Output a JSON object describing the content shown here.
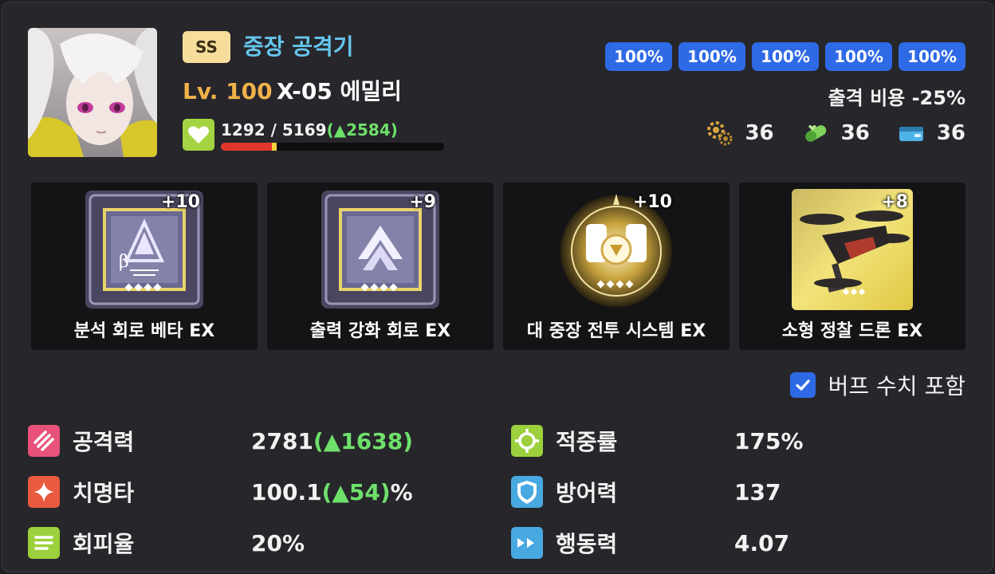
{
  "character": {
    "grade": "SS",
    "class": "중장 공격기",
    "level_label": "Lv. 100",
    "name": "X-05 에밀리",
    "affinity": {
      "current": "1292",
      "separator": " / ",
      "max": "5169",
      "bonus_open": "(",
      "bonus": "▲2584",
      "bonus_close": ")",
      "fill_fraction": 0.25
    }
  },
  "parts_percentages": [
    "100%",
    "100%",
    "100%",
    "100%",
    "100%"
  ],
  "sortie_cost": "출격 비용 -25%",
  "resources": [
    {
      "icon": "gear-parts-icon",
      "value": "36"
    },
    {
      "icon": "capsule-icon",
      "value": "36"
    },
    {
      "icon": "wallet-icon",
      "value": "36"
    }
  ],
  "equipment": [
    {
      "name": "분석 회로 베타 EX",
      "plus": "+10",
      "icon": "analysis-circuit-beta-icon"
    },
    {
      "name": "출력 강화 회로 EX",
      "plus": "+9",
      "icon": "output-circuit-icon"
    },
    {
      "name": "대 중장 전투 시스템 EX",
      "plus": "+10",
      "icon": "heavy-combat-system-icon"
    },
    {
      "name": "소형 정찰 드론 EX",
      "plus": "+8",
      "icon": "scout-drone-icon"
    }
  ],
  "buff_toggle": {
    "label": "버프 수치 포함",
    "checked": true
  },
  "stats": {
    "attack": {
      "label": "공격력",
      "base": "2781",
      "open": "(",
      "bonus": "▲1638",
      "close": ")",
      "suffix": ""
    },
    "crit": {
      "label": "치명타",
      "base": "100.1",
      "open": "(",
      "bonus": "▲54",
      "close": ")",
      "suffix": "%"
    },
    "evasion": {
      "label": "회피율",
      "base": "20%"
    },
    "accuracy": {
      "label": "적중률",
      "base": "175%"
    },
    "defense": {
      "label": "방어력",
      "base": "137"
    },
    "mobility": {
      "label": "행동력",
      "base": "4.07"
    }
  },
  "colors": {
    "accent_blue": "#2f6ae6",
    "grade_badge": "#f6dd9b",
    "class_text": "#66c6ee",
    "level_text": "#f0b24a",
    "bonus_green": "#6ee06a",
    "affinity_fill": "#e0372c"
  }
}
